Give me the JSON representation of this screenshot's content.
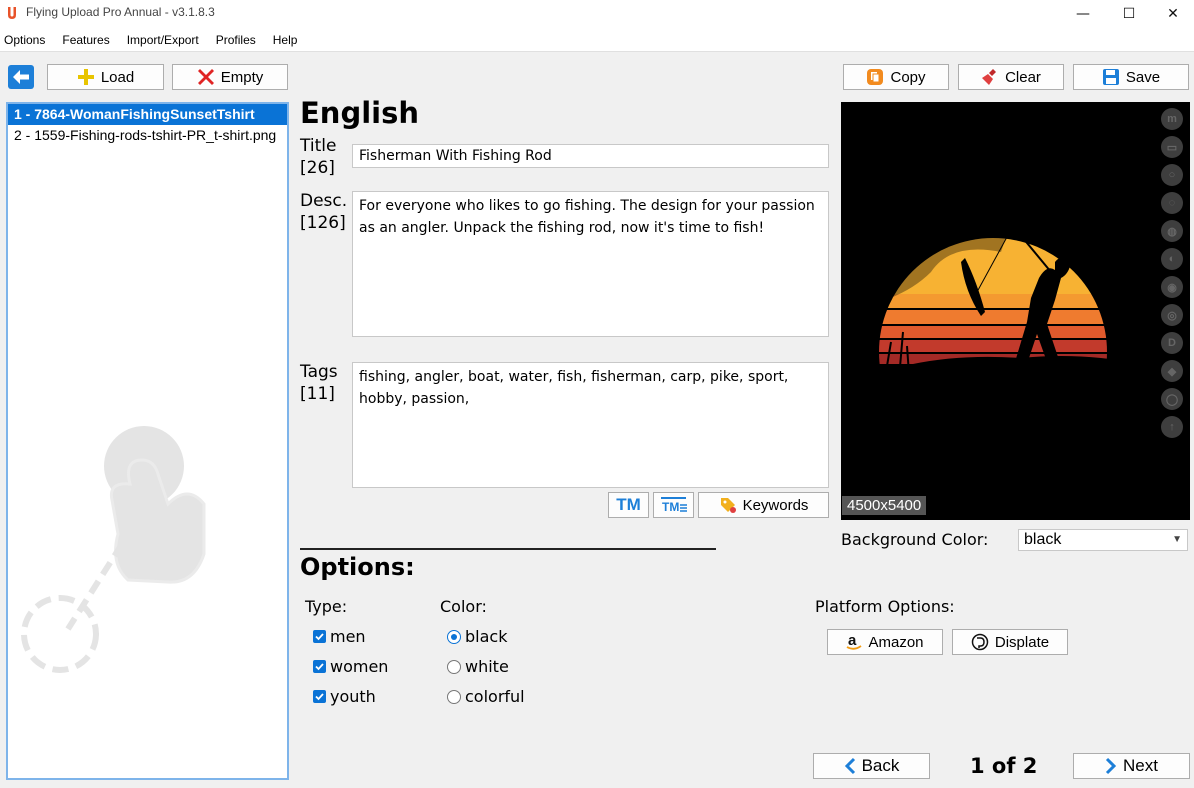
{
  "window": {
    "title": "Flying Upload Pro Annual - v3.1.8.3",
    "minimize": "—",
    "maximize": "☐",
    "close": "✕"
  },
  "menu": [
    "Options",
    "Features",
    "Import/Export",
    "Profiles",
    "Help"
  ],
  "toolbar": {
    "load": "Load",
    "empty": "Empty",
    "copy": "Copy",
    "clear": "Clear",
    "save": "Save"
  },
  "files": [
    {
      "label": "1 - 7864-WomanFishingSunsetTshirt",
      "selected": true
    },
    {
      "label": "2 - 1559-Fishing-rods-tshirt-PR_t-shirt.png",
      "selected": false
    }
  ],
  "editor": {
    "language": "English",
    "title_label": "Title",
    "title_count": "[26]",
    "title_value": "Fisherman With Fishing Rod",
    "desc_label": "Desc.",
    "desc_count": "[126]",
    "desc_value": "For everyone who likes to go fishing. The design for your passion as an angler. Unpack the fishing rod, now it's time to fish!",
    "tags_label": "Tags",
    "tags_count": "[11]",
    "tags_value": "fishing, angler, boat, water, fish, fisherman, carp, pike, sport, hobby, passion,",
    "tm_button": "TM",
    "keywords_button": "Keywords"
  },
  "options": {
    "heading": "Options:",
    "type_heading": "Type:",
    "types": [
      {
        "label": "men",
        "checked": true
      },
      {
        "label": "women",
        "checked": true
      },
      {
        "label": "youth",
        "checked": true
      }
    ],
    "color_heading": "Color:",
    "colors": [
      {
        "label": "black",
        "selected": true
      },
      {
        "label": "white",
        "selected": false
      },
      {
        "label": "colorful",
        "selected": false
      }
    ],
    "platform_heading": "Platform Options:",
    "amazon": "Amazon",
    "displate": "Displate"
  },
  "preview": {
    "dimensions": "4500x5400",
    "background_label": "Background Color:",
    "background_value": "black",
    "side_icons": [
      "m",
      "▭",
      "○",
      "◌",
      "◍",
      "◐",
      "◉",
      "◎",
      "D",
      "◆",
      "◯",
      "↑"
    ]
  },
  "navigation": {
    "back": "Back",
    "next": "Next",
    "page_indicator": "1 of 2"
  },
  "colors": {
    "accent": "#0a73d6",
    "sunset_top": "#f7b233",
    "sunset_mid": "#ef7b2f",
    "sunset_low": "#c23a2c"
  }
}
